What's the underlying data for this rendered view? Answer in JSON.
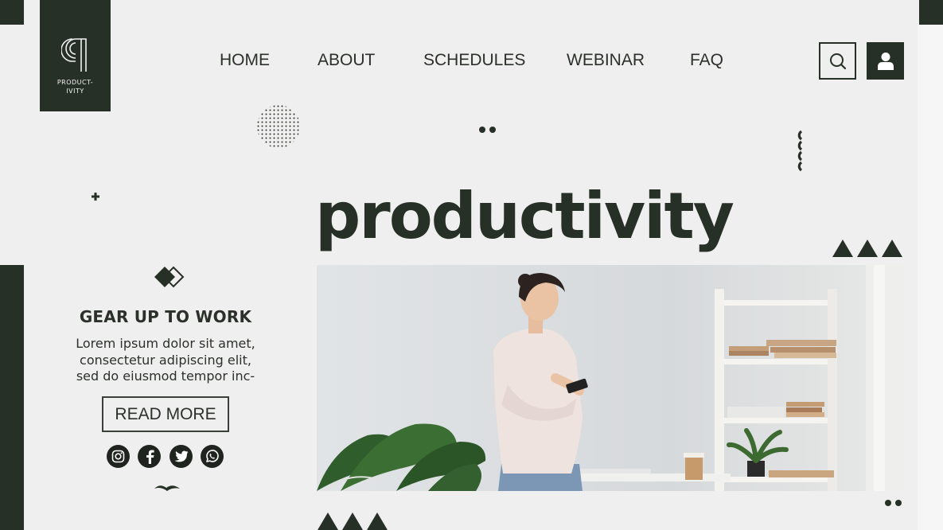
{
  "brand": {
    "logo_text": "PRODUCT-\nIVITY",
    "accent": "#273027",
    "background": "#f0efef"
  },
  "nav": {
    "items": [
      {
        "label": "HOME"
      },
      {
        "label": "ABOUT"
      },
      {
        "label": "SCHEDULES"
      },
      {
        "label": "WEBINAR"
      },
      {
        "label": "FAQ"
      }
    ],
    "search_icon": "search-icon",
    "user_icon": "user-icon"
  },
  "hero": {
    "title": "productivity"
  },
  "promo": {
    "heading": "GEAR UP TO WORK",
    "body": "Lorem ipsum dolor sit amet,\nconsectetur adipiscing elit,\nsed do eiusmod tempor inc-",
    "button_label": "READ MORE"
  },
  "social": [
    "instagram-icon",
    "facebook-icon",
    "twitter-icon",
    "whatsapp-icon"
  ]
}
